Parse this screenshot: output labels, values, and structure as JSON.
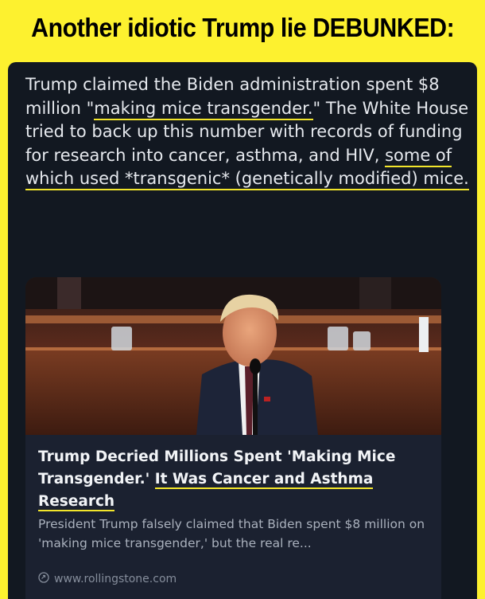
{
  "banner": {
    "title": "Another idiotic Trump lie DEBUNKED:"
  },
  "post": {
    "text_parts": [
      "Trump claimed the Biden administration spent $8 million \"",
      "making mice transgender.",
      "\" The White House tried to back up this number with records of funding for research into cancer, asthma, and HIV, ",
      "some of which used *transgenic* (genetically modified) mice."
    ]
  },
  "card": {
    "title_parts": [
      "Trump Decried Millions Spent 'Making Mice Transgender.' ",
      "It Was Cancer and Asthma Research"
    ],
    "description": "President Trump falsely claimed that Biden spent $8 million on 'making mice transgender,' but the real re...",
    "source": "www.rollingstone.com",
    "source_icon": "link-icon",
    "photo_alt_icon": "news-photo"
  },
  "colors": {
    "banner_bg": "#fdf12f",
    "post_bg": "#121821",
    "card_bg": "#1b2130",
    "highlight": "#f2e52b"
  }
}
